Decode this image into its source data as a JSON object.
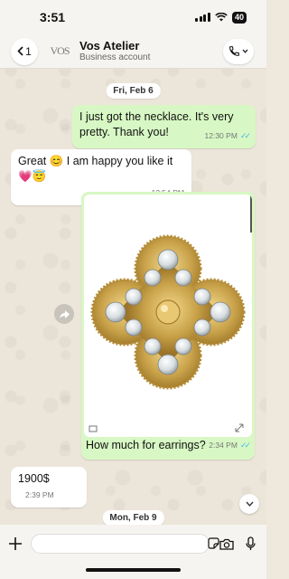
{
  "status_bar": {
    "time": "3:51",
    "battery": "40"
  },
  "header": {
    "back_count": "1",
    "logo_text": "VOS",
    "title": "Vos Atelier",
    "subtitle": "Business account"
  },
  "messages": {
    "date1": "Fri, Feb 6",
    "m1": {
      "text": "I just got the necklace. It's very pretty. Thank you!",
      "time": "12:30 PM"
    },
    "m2": {
      "text": "Great 😊 I am happy you like it 💗😇",
      "time": "12:54 PM"
    },
    "m3": {
      "caption": "How much for earrings?",
      "time": "2:34 PM",
      "image": "four-leaf-diamond-earring"
    },
    "m4": {
      "text": "1900$",
      "time": "2:39 PM"
    },
    "date2": "Mon, Feb 9"
  },
  "colors": {
    "outgoing": "#d7f8c4",
    "incoming": "#ffffff",
    "read_ticks": "#4fb6ec",
    "gold": "#c9a24a"
  }
}
